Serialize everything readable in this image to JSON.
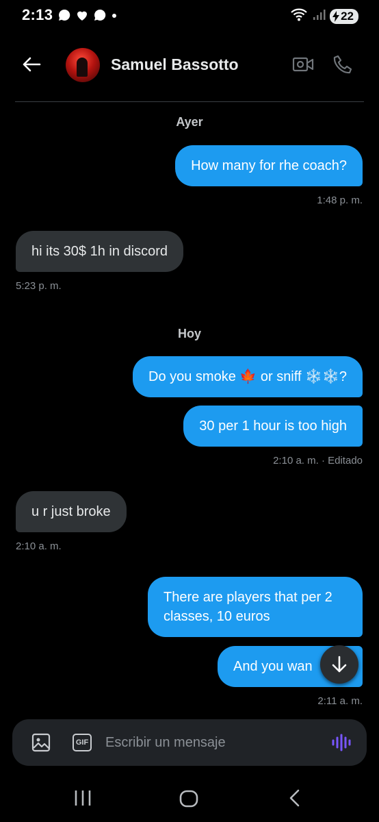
{
  "status_bar": {
    "time": "2:13",
    "battery": "22"
  },
  "header": {
    "contact_name": "Samuel Bassotto",
    "icons": [
      "back-arrow-icon",
      "video-call-icon",
      "phone-call-icon"
    ]
  },
  "conversation": {
    "day_yesterday": "Ayer",
    "day_today": "Hoy",
    "messages": [
      {
        "direction": "out",
        "text": "How many for rhe coach?",
        "time": "1:48 p. m."
      },
      {
        "direction": "in",
        "text": "hi its 30$ 1h in discord",
        "time": "5:23 p. m."
      },
      {
        "direction": "out",
        "text": "Do you smoke 🍁 or sniff ❄️❄️?"
      },
      {
        "direction": "out",
        "text": "30 per 1 hour is too high",
        "time": "2:10 a. m. · Editado"
      },
      {
        "direction": "in",
        "text": "u r just broke",
        "time": "2:10 a. m."
      },
      {
        "direction": "out",
        "text": "There are players that per 2 classes, 10 euros"
      },
      {
        "direction": "out",
        "text": "And you wan",
        "time": "2:11 a. m."
      }
    ]
  },
  "composer": {
    "placeholder": "Escribir un mensaje",
    "gif_label": "GIF"
  },
  "colors": {
    "outgoing_bubble": "#1d9bf0",
    "incoming_bubble": "#2f3336",
    "voice_accent": "#7856ff"
  }
}
